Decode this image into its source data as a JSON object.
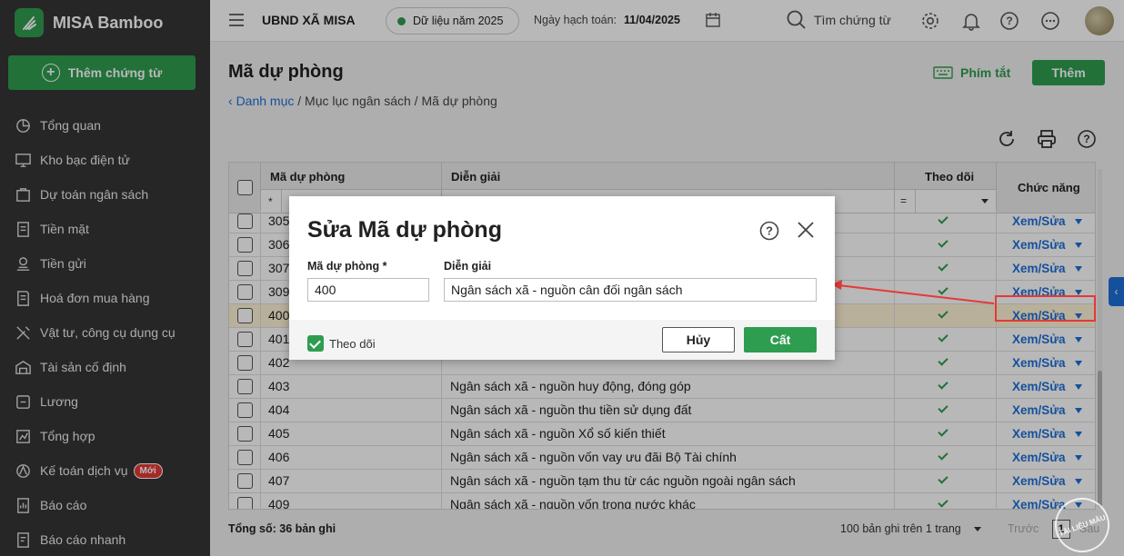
{
  "app": {
    "name": "MISA Bamboo",
    "add_voucher_label": "Thêm chứng từ"
  },
  "sidebar": {
    "items": [
      {
        "label": "Tổng quan",
        "icon": "chart-pie-icon"
      },
      {
        "label": "Kho bạc điện tử",
        "icon": "monitor-icon"
      },
      {
        "label": "Dự toán ngân sách",
        "icon": "budget-icon"
      },
      {
        "label": "Tiền mặt",
        "icon": "cash-icon"
      },
      {
        "label": "Tiền gửi",
        "icon": "deposit-icon"
      },
      {
        "label": "Hoá đơn mua hàng",
        "icon": "invoice-icon"
      },
      {
        "label": "Vật tư, công cụ dụng cụ",
        "icon": "tools-icon"
      },
      {
        "label": "Tài sản cố định",
        "icon": "building-icon"
      },
      {
        "label": "Lương",
        "icon": "salary-icon"
      },
      {
        "label": "Tổng hợp",
        "icon": "summary-icon"
      },
      {
        "label": "Kế toán dịch vụ",
        "icon": "service-icon",
        "badge": "Mới"
      },
      {
        "label": "Báo cáo",
        "icon": "report-icon"
      },
      {
        "label": "Báo cáo nhanh",
        "icon": "quick-report-icon"
      }
    ]
  },
  "topbar": {
    "org": "UBND XÃ MISA",
    "data_year": "Dữ liệu năm 2025",
    "posting_date_label": "Ngày hạch toán:",
    "posting_date": "11/04/2025",
    "search_placeholder": "Tìm chứng từ"
  },
  "page": {
    "title": "Mã dự phòng",
    "shortcut_label": "Phím tắt",
    "add_label": "Thêm",
    "breadcrumb_back": "Danh mục",
    "breadcrumb_rest": " / Mục lục ngân sách / Mã dự phòng"
  },
  "grid": {
    "columns": {
      "code": "Mã dự phòng",
      "desc": "Diễn giải",
      "track": "Theo dõi",
      "action": "Chức năng"
    },
    "filter_code": "*",
    "filter_track": "=",
    "rows": [
      {
        "code": "305",
        "desc": "",
        "action": "Xem/Sửa"
      },
      {
        "code": "306",
        "desc": "",
        "action": "Xem/Sửa"
      },
      {
        "code": "307",
        "desc": "",
        "action": "Xem/Sửa"
      },
      {
        "code": "309",
        "desc": "",
        "action": "Xem/Sửa"
      },
      {
        "code": "400",
        "desc": "",
        "action": "Xem/Sửa"
      },
      {
        "code": "401",
        "desc": "",
        "action": "Xem/Sửa"
      },
      {
        "code": "402",
        "desc": "",
        "action": "Xem/Sửa"
      },
      {
        "code": "403",
        "desc": "Ngân sách xã - nguồn huy động, đóng góp",
        "action": "Xem/Sửa"
      },
      {
        "code": "404",
        "desc": "Ngân sách xã - nguồn thu tiền sử dụng đất",
        "action": "Xem/Sửa"
      },
      {
        "code": "405",
        "desc": "Ngân sách xã - nguồn Xổ số kiến thiết",
        "action": "Xem/Sửa"
      },
      {
        "code": "406",
        "desc": "Ngân sách xã - nguồn vốn vay ưu đãi Bộ Tài chính",
        "action": "Xem/Sửa"
      },
      {
        "code": "407",
        "desc": "Ngân sách xã - nguồn tạm thu từ các nguồn ngoài ngân sách",
        "action": "Xem/Sửa"
      },
      {
        "code": "409",
        "desc": "Ngân sách xã - nguồn vốn trong nước khác",
        "action": "Xem/Sửa"
      }
    ],
    "total": "Tổng số: 36 bản ghi",
    "per_page": "100 bản ghi trên 1 trang",
    "prev": "Trước",
    "page_number": "1",
    "next": "Sau"
  },
  "dialog": {
    "title": "Sửa Mã dự phòng",
    "code_label": "Mã dự phòng *",
    "code_value": "400",
    "desc_label": "Diễn giải",
    "desc_value": "Ngân sách xã - nguồn cân đối ngân sách",
    "track_label": "Theo dõi",
    "cancel": "Hủy",
    "save": "Cất"
  },
  "watermark": "TÀI LIỆU MẪU",
  "colors": {
    "brand_green": "#2e9d4f",
    "link_blue": "#1e6fd9",
    "highlight_red": "#e53935",
    "sidebar_bg": "#353535"
  }
}
